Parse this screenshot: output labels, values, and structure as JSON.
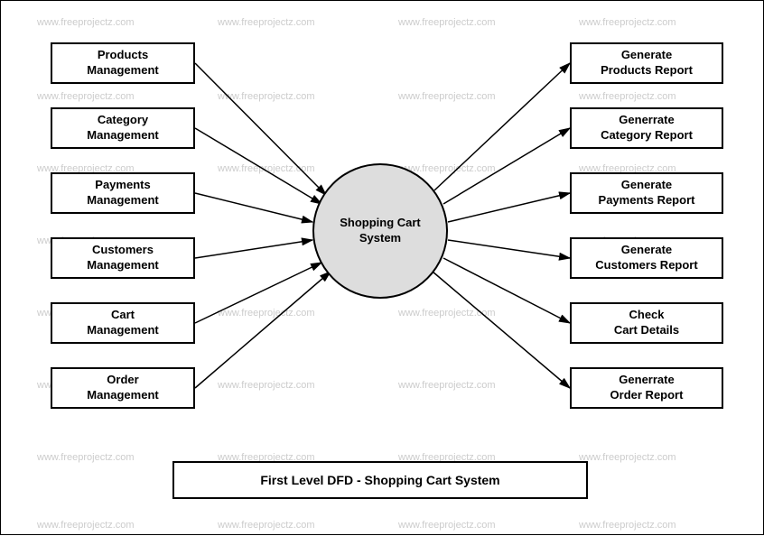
{
  "watermark": "www.freeprojectz.com",
  "center": {
    "label": "Shopping Cart\nSystem"
  },
  "left_boxes": [
    {
      "label": "Products\nManagement"
    },
    {
      "label": "Category\nManagement"
    },
    {
      "label": "Payments\nManagement"
    },
    {
      "label": "Customers\nManagement"
    },
    {
      "label": "Cart\nManagement"
    },
    {
      "label": "Order\nManagement"
    }
  ],
  "right_boxes": [
    {
      "label": "Generate\nProducts Report"
    },
    {
      "label": "Generrate\nCategory Report"
    },
    {
      "label": "Generate\nPayments Report"
    },
    {
      "label": "Generate\nCustomers Report"
    },
    {
      "label": "Check\nCart Details"
    },
    {
      "label": "Generrate\nOrder Report"
    }
  ],
  "title": "First Level DFD - Shopping Cart System",
  "diagram_meta": {
    "type": "data-flow-diagram",
    "level": "first",
    "system": "Shopping Cart System",
    "inputs": [
      "Products Management",
      "Category Management",
      "Payments Management",
      "Customers Management",
      "Cart Management",
      "Order Management"
    ],
    "outputs": [
      "Generate Products Report",
      "Generrate Category Report",
      "Generate Payments Report",
      "Generate Customers Report",
      "Check Cart Details",
      "Generrate Order Report"
    ]
  }
}
